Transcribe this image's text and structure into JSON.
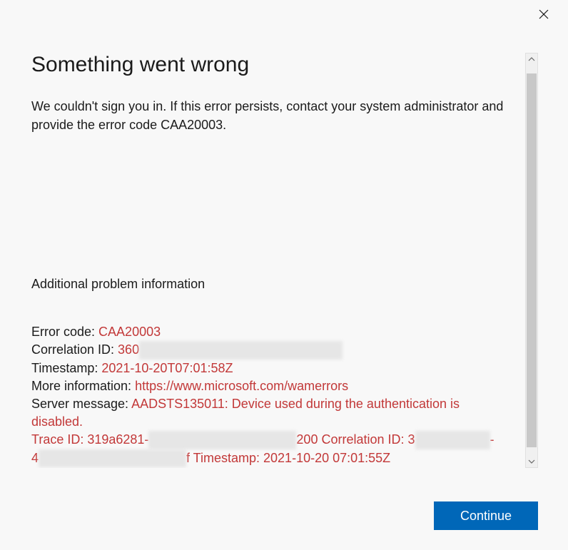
{
  "window": {
    "close_icon": "close"
  },
  "header": {
    "title": "Something went wrong",
    "description": "We couldn't sign you in. If this error persists, contact your system administrator and provide the error code CAA20003."
  },
  "additional": {
    "heading": "Additional problem information",
    "error_code_label": "Error code: ",
    "error_code_value": "CAA20003",
    "correlation_label": "Correlation ID: ",
    "correlation_prefix": "360",
    "timestamp_label": "Timestamp: ",
    "timestamp_value": "2021-10-20T07:01:58Z",
    "more_info_label": "More information: ",
    "more_info_value": "https://www.microsoft.com/wamerrors",
    "server_msg_label": "Server message: ",
    "server_msg_value": "AADSTS135011: Device used during the authentication is disabled.",
    "trace_line_1a": "Trace ID: 319a6281-",
    "trace_line_1b": "200 Correlation ID: 3",
    "trace_line_1c": "-",
    "trace_line_2a": "4",
    "trace_line_2b": "f Timestamp: 2021-10-20 07:01:55Z"
  },
  "footer": {
    "continue_label": "Continue"
  }
}
